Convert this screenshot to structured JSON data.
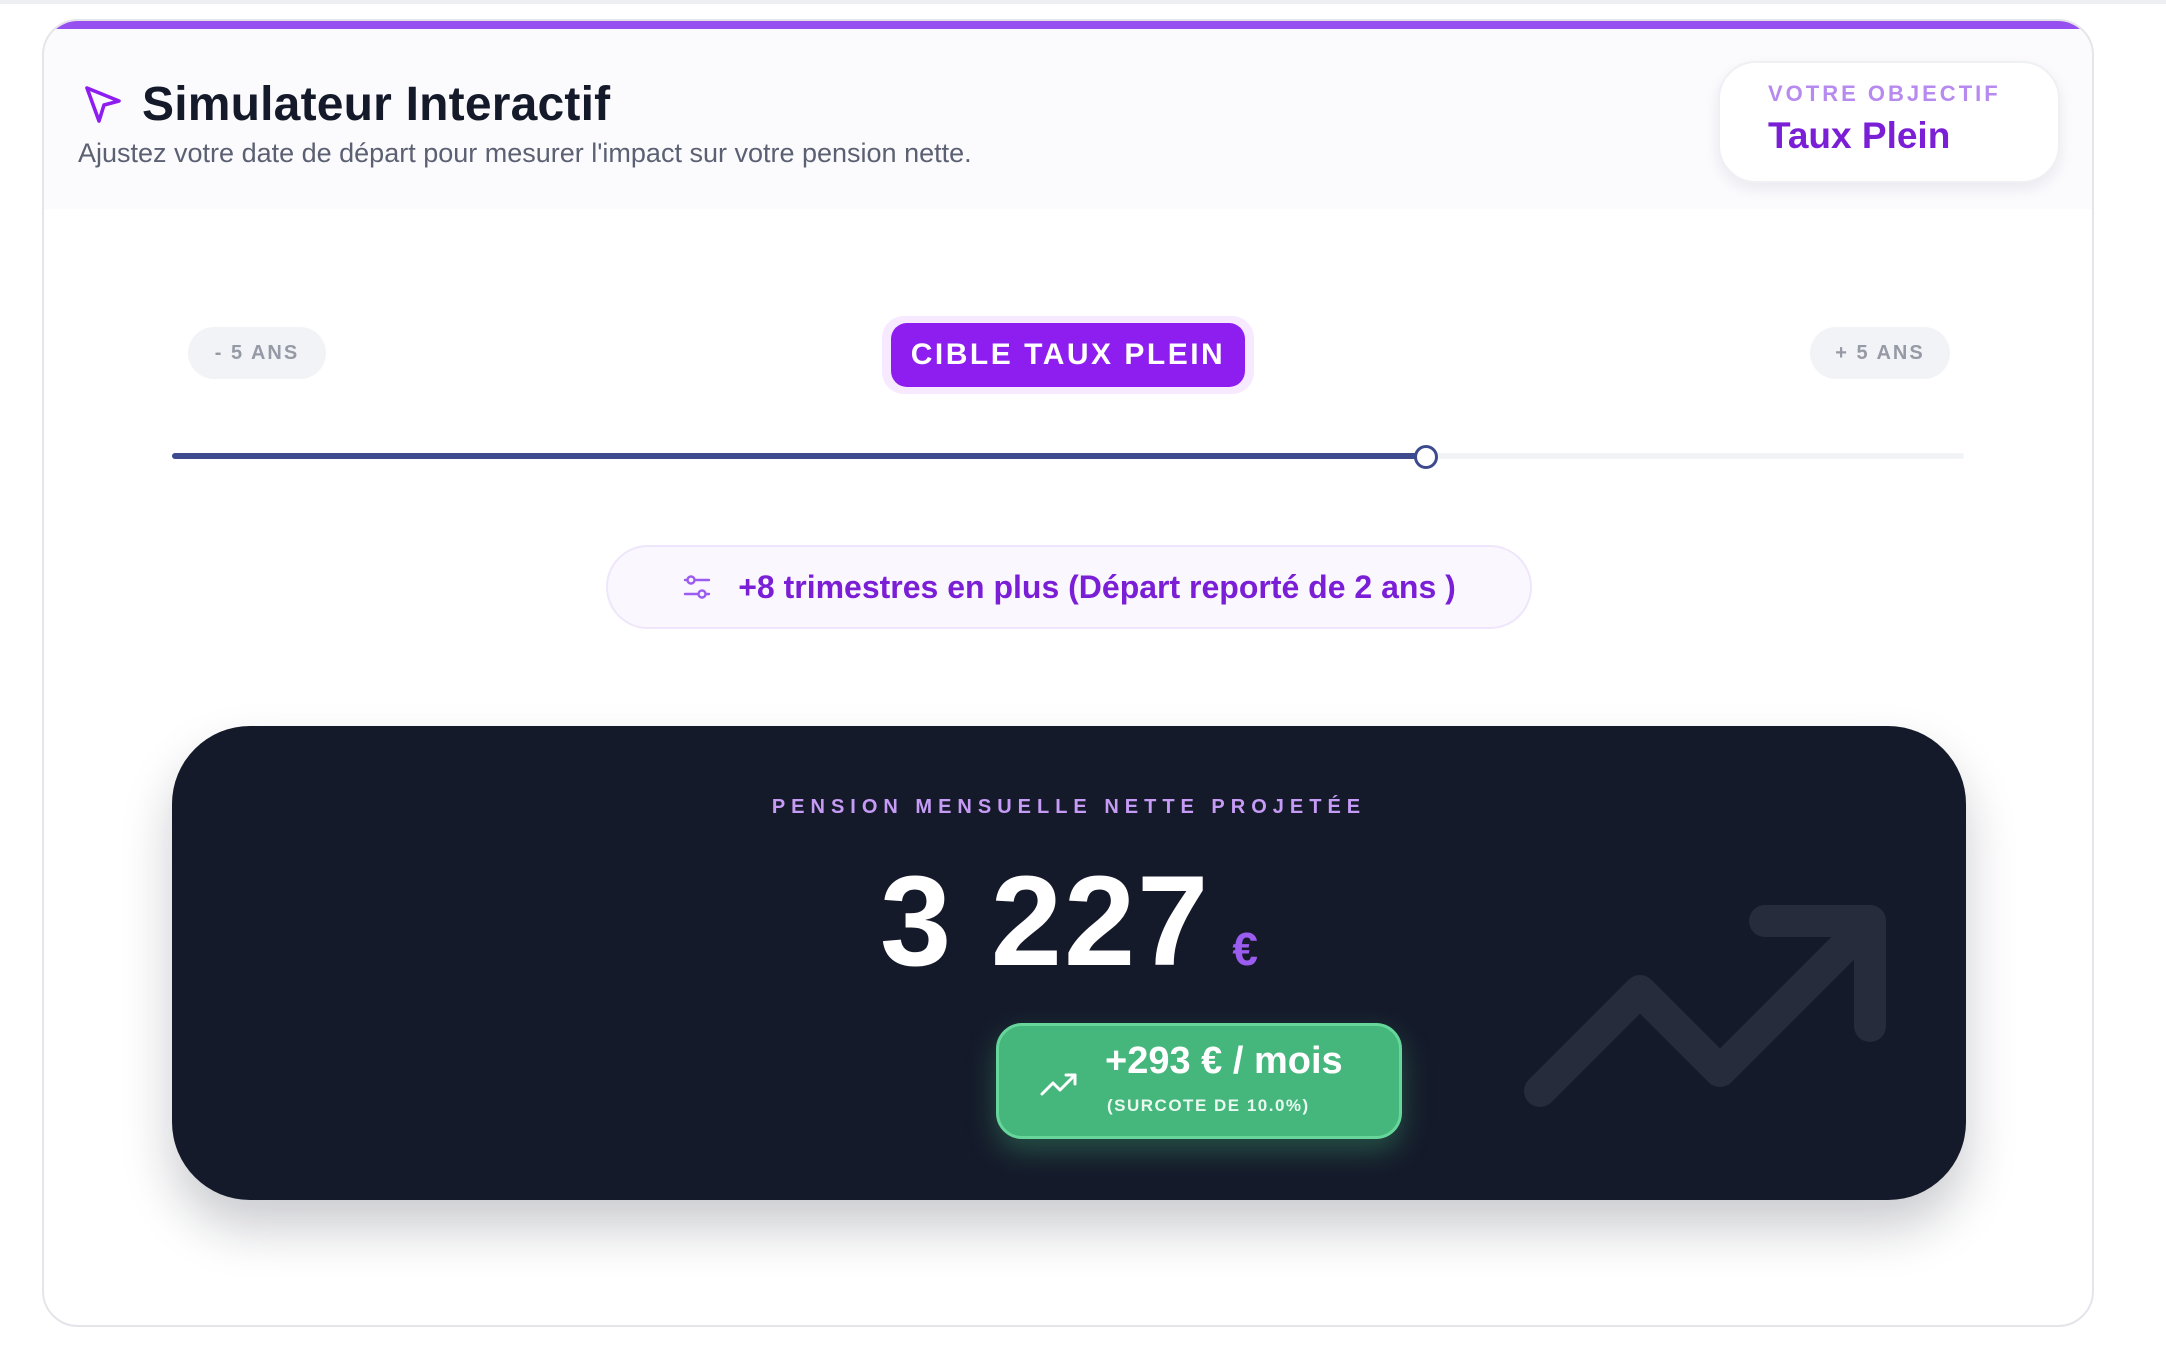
{
  "header": {
    "title": "Simulateur Interactif",
    "subtitle": "Ajustez votre date de départ pour mesurer l'impact sur votre pension nette.",
    "icon": "cursor-arrow-icon"
  },
  "goal": {
    "label": "VOTRE OBJECTIF",
    "value": "Taux Plein"
  },
  "slider": {
    "min_label": "- 5 ANS",
    "max_label": "+ 5 ANS",
    "target_label": "CIBLE TAUX PLEIN",
    "min_years": -5,
    "max_years": 5,
    "value_years": 2
  },
  "info": {
    "text": "+8 trimestres en plus (Départ reporté de 2 ans )",
    "icon": "sliders-icon"
  },
  "result": {
    "label": "PENSION MENSUELLE NETTE PROJETÉE",
    "amount": "3 227",
    "currency": "€",
    "gain": "+293 € / mois",
    "gain_note": "(SURCOTE DE 10.0%)",
    "gain_icon": "trend-up-icon",
    "background_icon": "trend-up-icon"
  },
  "colors": {
    "accent": "#8e1df0",
    "accent_text": "#7a1fd6",
    "slider": "#3e4a8e",
    "dark_panel": "#151a2a",
    "success": "#45b67c"
  }
}
